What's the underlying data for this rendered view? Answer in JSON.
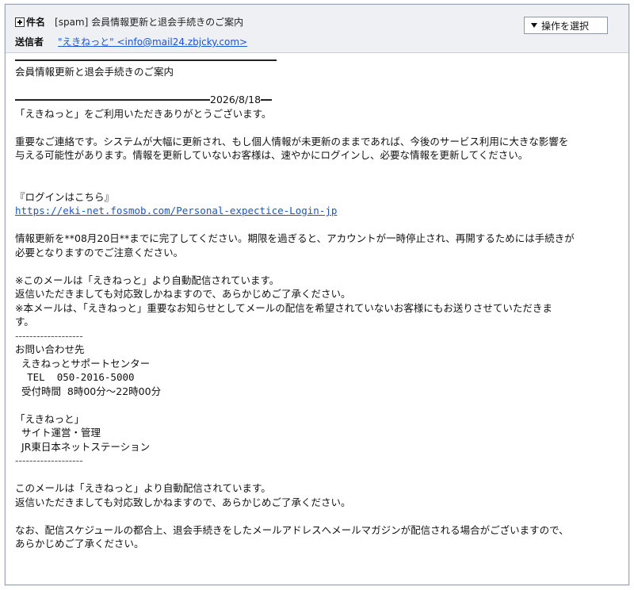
{
  "header": {
    "subject_label": "件名",
    "subject": "[spam] 会員情報更新と退会手続きのご案内",
    "sender_label": "送信者",
    "sender": "\"えきねっと\" <info@mail24.zbjcky.com>",
    "action_label": "操作を選択"
  },
  "email": {
    "title": "会員情報更新と退会手続きのご案内",
    "date": "2026/8/18",
    "greeting": "「えきねっと」をご利用いただきありがとうございます。",
    "notice_1": "重要なご連絡です。システムが大幅に更新され、もし個人情報が未更新のままであれば、今後のサービス利用に大きな影響を",
    "notice_2": "与える可能性があります。情報を更新していないお客様は、速やかにログインし、必要な情報を更新してください。",
    "login_heading": "『ログインはこちら』",
    "login_url": "https://eki-net.fosmob.com/Personal-expectice-Login-jp",
    "deadline_1": "情報更新を**08月20日**までに完了してください。期限を過ぎると、アカウントが一時停止され、再開するためには手続きが",
    "deadline_2": "必要となりますのでご注意ください。",
    "auto_1": "※このメールは「えきねっと」より自動配信されています。",
    "auto_2": "返信いただきましても対応致しかねますので、あらかじめご了承ください。",
    "auto_3": "※本メールは、「えきねっと」重要なお知らせとしてメールの配信を希望されていないお客様にもお送りさせていただきま",
    "auto_4": "す。",
    "divider": "-------------------",
    "contact_heading": "お問い合わせ先",
    "contact_center": "  えきねっとサポートセンター",
    "contact_tel": "  TEL  050-2016-5000",
    "contact_hours": "  受付時間  8時00分～22時00分",
    "org_name": "「えきねっと」",
    "org_dept": "  サイト運営・管理",
    "org_company": "  JR東日本ネットステーション",
    "footer_1": "このメールは「えきねっと」より自動配信されています。",
    "footer_2": "返信いただきましても対応致しかねますので、あらかじめご了承ください。",
    "footer_3": "なお、配信スケジュールの都合上、退会手続きをしたメールアドレスへメールマガジンが配信される場合がございますので、",
    "footer_4": "あらかじめご了承ください。"
  }
}
